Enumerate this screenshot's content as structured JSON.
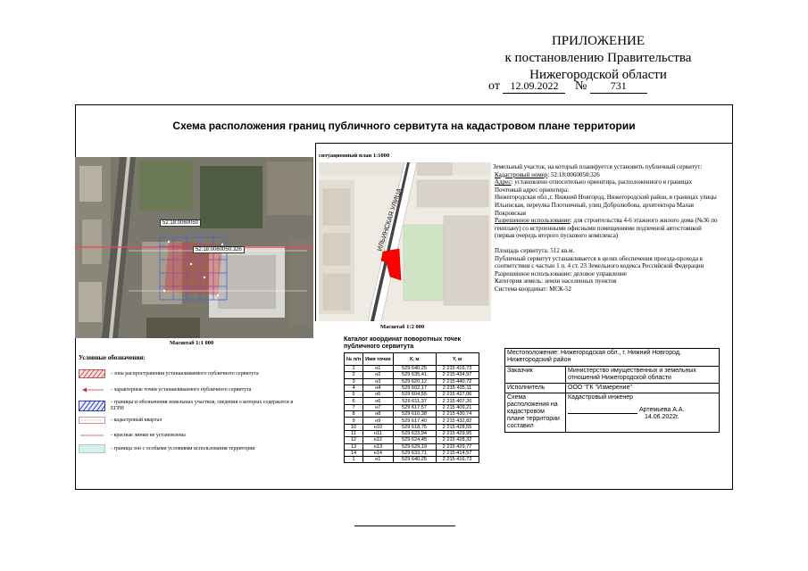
{
  "header": {
    "line1": "ПРИЛОЖЕНИЕ",
    "line2": "к постановлению Правительства",
    "line3": "Нижегородской области",
    "from_label": "от",
    "date": "12.09.2022",
    "number_label": "№",
    "number": "731"
  },
  "title": "Схема расположения границ  публичного сервитута на кадастровом плане территории",
  "satellite": {
    "label_top": "52:18:0060050",
    "label_main": "52:18:0060050:326",
    "scale": "Масштаб 1:1 000"
  },
  "situational": {
    "title": "ситуационный план 1:1000",
    "street": "ИЛЬИНСКАЯ УЛИЦА",
    "scale": "Масштаб 1:2 000"
  },
  "description": {
    "intro": "Земельный участок, на который планируется установить публичный сервитут:",
    "cadnum_label": "Кадастровый номер",
    "cadnum": ": 52:18:0060050:326",
    "address_label": "Адрес",
    "address": ": установлено относительно ориентира, расположенного в границах",
    "postal": "Почтовый адрес ориентира:",
    "postal_value": "Нижегородская обл.,г. Нижний Новгород, Нижегородский район, в границах улицы Ильинская,  переулка Плотничный, улиц Добролюбова, архитектора Малая Покровская",
    "use_label": "Разрешенное использование",
    "use": ": для строительства 4-6 этажного жилого дома (№36 по генплану) со встроенными офисными помещениями подземной автостоянкой (первая очередь второго пускового комплекса)",
    "area": "Площадь сервитута: 512 кв.м.",
    "purpose": "Публичный сервитут устанавливается в целях обеспечения проезда-прохода в соответствии с частью 1 п. 4 ст. 23 Земельного кодекса Российской Федерации",
    "use2": "Разрешенное использование: деловое управление",
    "category": "Категория земель: земли населенных пунктов",
    "coords": "Система координат: МСК-52"
  },
  "legend": {
    "title": "Условные обозначения:",
    "items": [
      "- зона распространения устанавливаемого публичного сервитута",
      "- характерные точки устанавливаемого публичного сервитута",
      "- границы и обозначения земельных участков, сведения о которых содержатся в ЕГРН",
      "- кадастровый квартал",
      "- красные линии не установлены",
      "- граница зон с особыми условиями использования территории"
    ]
  },
  "catalog": {
    "title": "Каталог координат поворотных точек публичного сервитута",
    "headers": [
      "№ п/п",
      "Имя точки",
      "X, м",
      "Y, м"
    ],
    "rows": [
      [
        "1",
        "н1",
        "529 640,25",
        "2 215 416,73"
      ],
      [
        "2",
        "н2",
        "529 635,41",
        "2 215 434,97"
      ],
      [
        "3",
        "н3",
        "529 620,12",
        "2 215 440,72"
      ],
      [
        "4",
        "н4",
        "529 602,17",
        "2 215 435,11"
      ],
      [
        "5",
        "н5",
        "529 604,55",
        "2 215 427,06"
      ],
      [
        "6",
        "н6",
        "529 611,37",
        "2 215 407,26"
      ],
      [
        "7",
        "н7",
        "529 617,57",
        "2 215 409,21"
      ],
      [
        "8",
        "н8",
        "529 610,38",
        "2 215 430,74"
      ],
      [
        "9",
        "н9",
        "529 617,40",
        "2 215 432,82"
      ],
      [
        "10",
        "н10",
        "529 618,75",
        "2 215 428,55"
      ],
      [
        "11",
        "н11",
        "529 623,94",
        "2 215 429,95"
      ],
      [
        "12",
        "н12",
        "529 624,45",
        "2 215 428,32"
      ],
      [
        "13",
        "н13",
        "529 629,19",
        "2 215 429,77"
      ],
      [
        "14",
        "н14",
        "529 633,71",
        "2 215 414,57"
      ],
      [
        "1",
        "н1",
        "529 640,25",
        "2 215 416,73"
      ]
    ]
  },
  "info": {
    "location": "Местоположение: Нижегородская обл., г. Нижний Новгород, Нижегородский район",
    "customer_label": "Заказчик",
    "customer": "Министерство имущественных и земельных отношений Нижегородской области",
    "executor_label": "Исполнитель",
    "executor": "ООО \"ГК \"Измерение\"",
    "scheme_label": "Схема расположения на кадастровом плане территории составил",
    "engineer_label": "Кадастровый инженер",
    "engineer_name": "Артемьева А.А.",
    "engineer_date": "14.06.2022г."
  }
}
